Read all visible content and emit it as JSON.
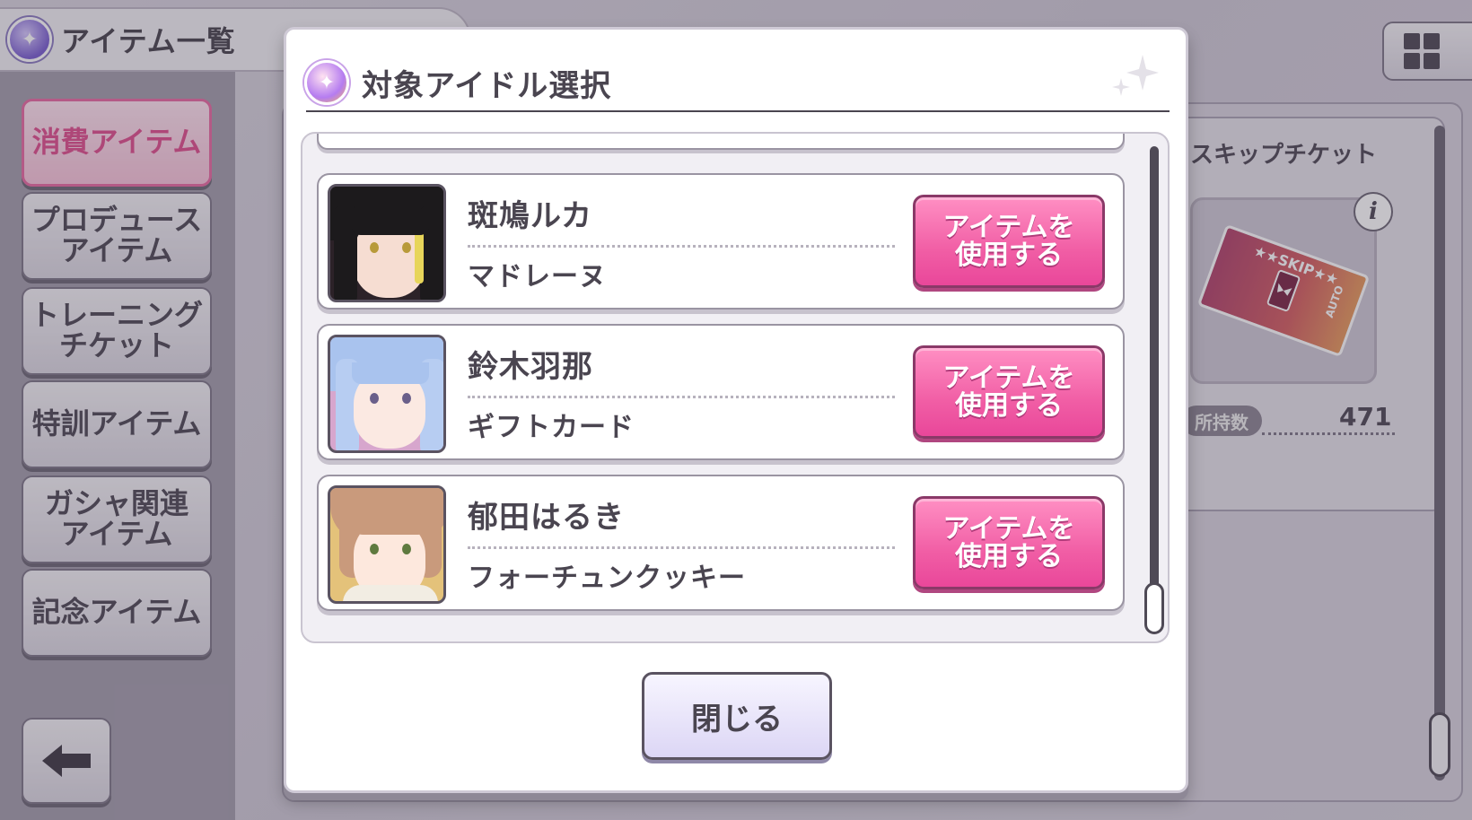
{
  "background": {
    "screen_title": "アイテム一覧",
    "categories": [
      {
        "label": "消費アイテム",
        "active": true
      },
      {
        "label": "プロデュース\nアイテム",
        "active": false
      },
      {
        "label": "トレーニング\nチケット",
        "active": false
      },
      {
        "label": "特訓アイテム",
        "active": false
      },
      {
        "label": "ガシャ関連\nアイテム",
        "active": false
      },
      {
        "label": "記念アイテム",
        "active": false
      }
    ],
    "item": {
      "name": "スキップチケット",
      "ticket_text_skip": "★★SKIP★★",
      "ticket_text_auto": "AUTO",
      "owned_label": "所持数",
      "owned_count": "471"
    }
  },
  "modal": {
    "title": "対象アイドル選択",
    "close_label": "閉じる",
    "idols": [
      {
        "name": "斑鳩ルカ",
        "item": "マドレーヌ",
        "button": "アイテムを\n使用する",
        "hair": "#1c1a1c",
        "bg": "#2c2228"
      },
      {
        "name": "鈴木羽那",
        "item": "ギフトカード",
        "button": "アイテムを\n使用する",
        "hair": "#a9c3ee",
        "bg": "#d7a6cd"
      },
      {
        "name": "郁田はるき",
        "item": "フォーチュンクッキー",
        "button": "アイテムを\n使用する",
        "hair": "#c99a7c",
        "bg": "#e4c27a"
      }
    ]
  },
  "colors": {
    "accent_pink": "#f15ea5",
    "active_category": "#e0508e",
    "text_dark": "#4a4550"
  }
}
